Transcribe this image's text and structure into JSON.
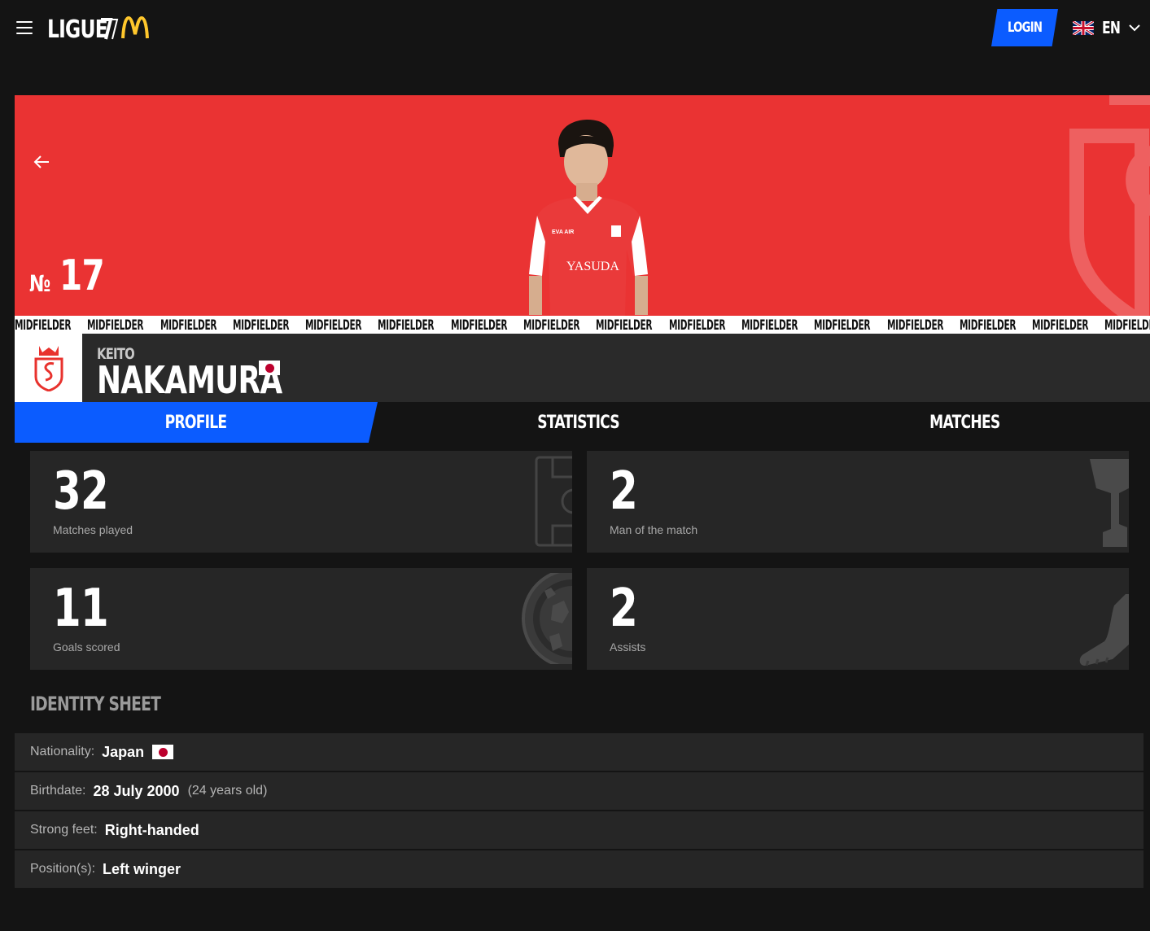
{
  "header": {
    "logo_text": "LIGUE",
    "logo_mark": "1",
    "login_label": "LOGIN",
    "language": "EN"
  },
  "colors": {
    "hero_red": "#ea3333",
    "accent_blue": "#0b5cff",
    "background": "#141414",
    "card": "#262626"
  },
  "player": {
    "number_prefix": "№",
    "number": "17",
    "position_ticker": "MIDFIELDER",
    "first_name": "KEITO",
    "last_name": "NAKAMURA",
    "nationality_flag": "japan-flag-icon"
  },
  "tabs": [
    {
      "label": "PROFILE",
      "active": true
    },
    {
      "label": "STATISTICS",
      "active": false
    },
    {
      "label": "MATCHES",
      "active": false
    }
  ],
  "stats": [
    {
      "value": "32",
      "label": "Matches played",
      "icon": "pitch-icon"
    },
    {
      "value": "2",
      "label": "Man of the match",
      "icon": "trophy-icon"
    },
    {
      "value": "11",
      "label": "Goals scored",
      "icon": "ball-icon"
    },
    {
      "value": "2",
      "label": "Assists",
      "icon": "boot-icon"
    }
  ],
  "identity_sheet": {
    "title": "IDENTITY SHEET",
    "rows": [
      {
        "key": "Nationality:",
        "value": "Japan",
        "extra": ""
      },
      {
        "key": "Birthdate:",
        "value": "28 July 2000",
        "extra": "(24 years old)"
      },
      {
        "key": "Strong feet:",
        "value": "Right-handed",
        "extra": ""
      },
      {
        "key": "Position(s):",
        "value": "Left winger",
        "extra": ""
      }
    ]
  }
}
